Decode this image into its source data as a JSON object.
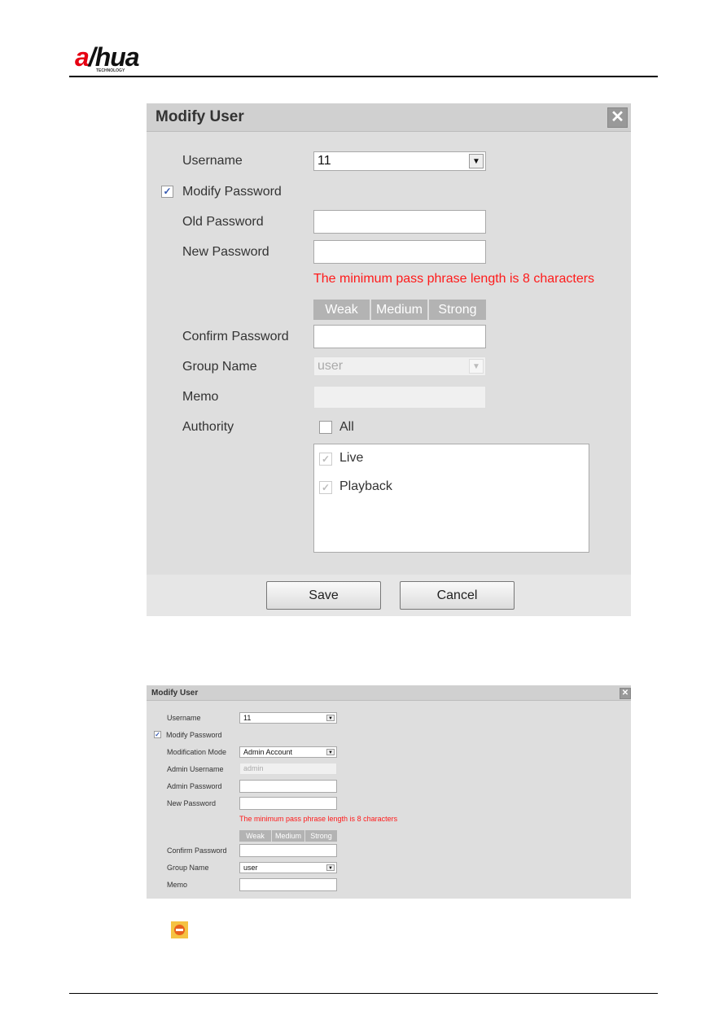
{
  "header": {
    "logo_text": "alhua",
    "logo_sub": "TECHNOLOGY"
  },
  "dialog1": {
    "title": "Modify User",
    "username_label": "Username",
    "username_value": "11",
    "modify_password_label": "Modify Password",
    "modify_password_checked": true,
    "old_password_label": "Old Password",
    "new_password_label": "New Password",
    "hint": "The minimum pass phrase length is 8 characters",
    "strength": [
      "Weak",
      "Medium",
      "Strong"
    ],
    "confirm_password_label": "Confirm Password",
    "group_name_label": "Group Name",
    "group_name_value": "user",
    "memo_label": "Memo",
    "authority_label": "Authority",
    "all_label": "All",
    "authorities": [
      "Live",
      "Playback"
    ],
    "save": "Save",
    "cancel": "Cancel"
  },
  "dialog2": {
    "title": "Modify User",
    "username_label": "Username",
    "username_value": "11",
    "modify_password_label": "Modify Password",
    "modification_mode_label": "Modification Mode",
    "modification_mode_value": "Admin Account",
    "admin_username_label": "Admin Username",
    "admin_username_value": "admin",
    "admin_password_label": "Admin Password",
    "new_password_label": "New Password",
    "hint": "The minimum pass phrase length is 8 characters",
    "strength": [
      "Weak",
      "Medium",
      "Strong"
    ],
    "confirm_password_label": "Confirm Password",
    "group_name_label": "Group Name",
    "group_name_value": "user",
    "memo_label": "Memo"
  },
  "colors": {
    "accent_red": "#ff1a1a",
    "note_icon": "#f5c242"
  },
  "icons": {
    "note": "no-entry-icon"
  }
}
